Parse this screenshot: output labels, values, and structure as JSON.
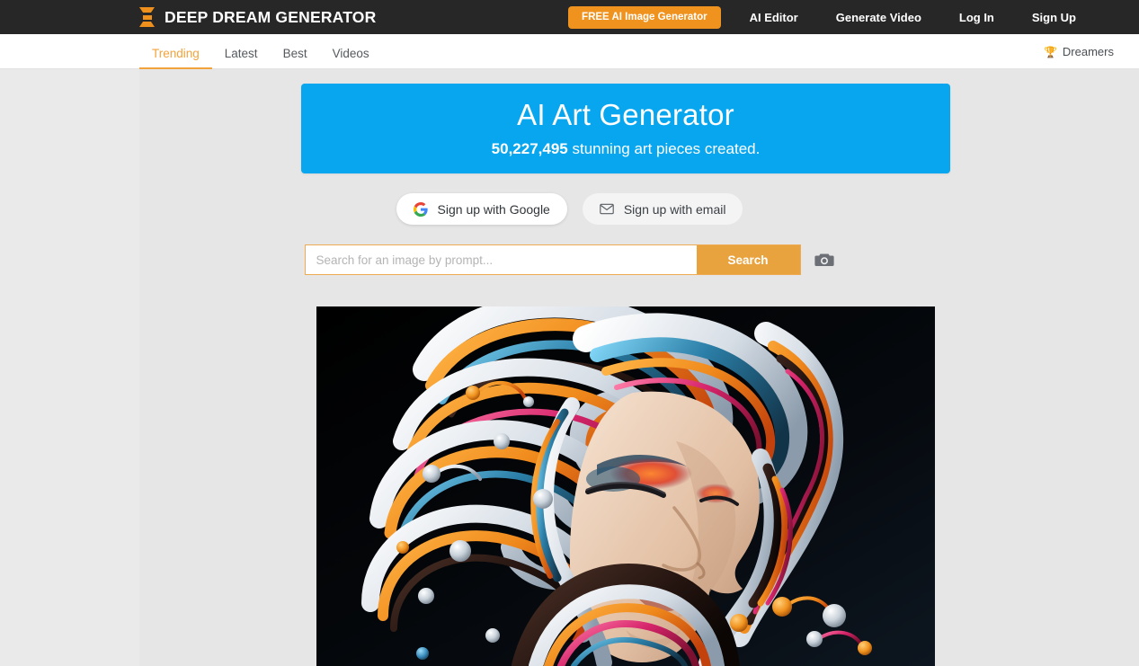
{
  "header": {
    "brand": "DEEP DREAM GENERATOR",
    "logo_icon": "hourglass-logo-icon",
    "cta_label": "FREE AI Image Generator",
    "nav": [
      {
        "label": "AI Editor",
        "name": "nav-ai-editor"
      },
      {
        "label": "Generate Video",
        "name": "nav-generate-video"
      },
      {
        "label": "Log In",
        "name": "nav-log-in"
      },
      {
        "label": "Sign Up",
        "name": "nav-sign-up"
      }
    ],
    "colors": {
      "bar": "#272727",
      "accent": "#f0921e",
      "text": "#ffffff"
    }
  },
  "subnav": {
    "tabs": [
      {
        "label": "Trending",
        "active": true
      },
      {
        "label": "Latest",
        "active": false
      },
      {
        "label": "Best",
        "active": false
      },
      {
        "label": "Videos",
        "active": false
      }
    ],
    "dreamers_label": "Dreamers",
    "dreamers_icon": "trophy-icon",
    "active_color": "#f2a33c"
  },
  "hero": {
    "title": "AI Art Generator",
    "count": "50,227,495",
    "subtitle_rest": " stunning art pieces created.",
    "background": "#07a6ef"
  },
  "signup": {
    "google_label": "Sign up with Google",
    "google_icon": "google-g-icon",
    "email_label": "Sign up with email",
    "email_icon": "envelope-icon"
  },
  "search": {
    "placeholder": "Search for an image by prompt...",
    "value": "",
    "button_label": "Search",
    "camera_icon": "camera-icon",
    "accent": "#e9a33e"
  },
  "artwork": {
    "alt": "AI generated portrait of a woman with flowing multicolored ribbon hair",
    "background": "#000000"
  }
}
